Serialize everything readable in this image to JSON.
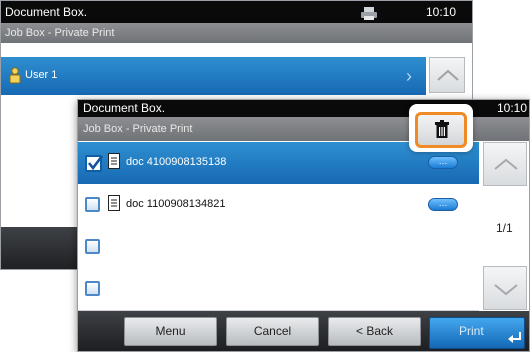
{
  "back_panel": {
    "title": "Document Box.",
    "time": "10:10",
    "subtitle": "Job Box - Private Print",
    "user_label": "User 1"
  },
  "front_panel": {
    "title": "Document Box.",
    "time": "10:10",
    "subtitle": "Job Box - Private Print",
    "documents": [
      {
        "name": "doc 4100908135138",
        "checked": true
      },
      {
        "name": "doc 1100908134821",
        "checked": false
      }
    ],
    "pill_label": "…",
    "page_indicator": "1/1"
  },
  "buttons": {
    "menu": "Menu",
    "cancel": "Cancel",
    "back": "< Back",
    "print": "Print"
  },
  "colors": {
    "highlight_ring": "#f08a24",
    "accent_blue": "#1f7dc8"
  }
}
